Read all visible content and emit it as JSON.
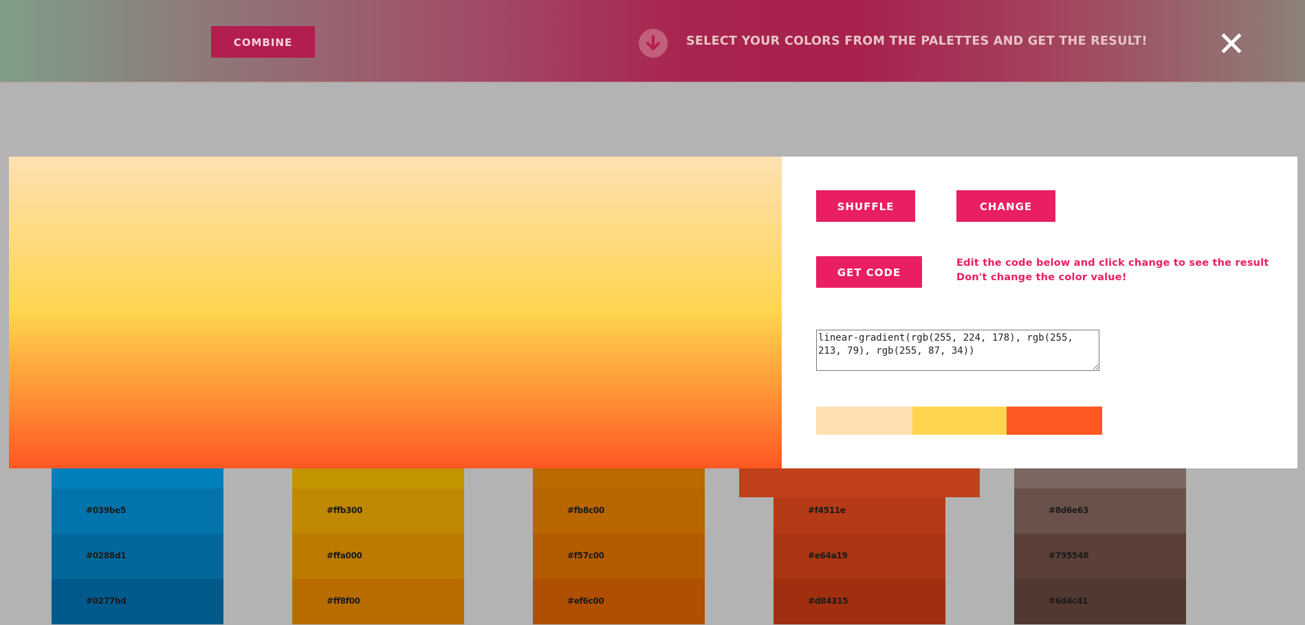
{
  "header": {
    "combine_label": "COMBINE",
    "hint_text": "SELECT YOUR COLORS FROM THE PALETTES AND GET THE RESULT!",
    "arrow_icon": "arrow-down-icon",
    "close_icon": "close-icon"
  },
  "modal": {
    "shuffle_label": "SHUFFLE",
    "change_label": "CHANGE",
    "get_code_label": "GET CODE",
    "note_line1": "Edit the code below and click change to see the result",
    "note_line2": "Don't change the color value!",
    "code_value": "linear-gradient(rgb(255, 224, 178), rgb(255, 213, 79), rgb(255, 87, 34))",
    "swatch_colors": [
      "#ffe0b2",
      "#ffd54f",
      "#ff5722"
    ],
    "preview_gradient": [
      "rgb(255, 224, 178)",
      "rgb(255, 213, 79)",
      "rgb(255, 87, 34)"
    ]
  },
  "palettes": [
    {
      "colors": [
        {
          "hex": "",
          "bg": "#0280bc"
        },
        {
          "hex": "#039be5",
          "bg": "#0273ab"
        },
        {
          "hex": "#0288d1",
          "bg": "#02689b"
        },
        {
          "hex": "#0277bd",
          "bg": "#025a8c"
        }
      ]
    },
    {
      "colors": [
        {
          "hex": "",
          "bg": "#c19400"
        },
        {
          "hex": "#ffb300",
          "bg": "#bf8800"
        },
        {
          "hex": "#ffa000",
          "bg": "#bc7b00"
        },
        {
          "hex": "#ff8f00",
          "bg": "#b96c00"
        }
      ]
    },
    {
      "colors": [
        {
          "hex": "",
          "bg": "#b96a00"
        },
        {
          "hex": "#fb8c00",
          "bg": "#b76600"
        },
        {
          "hex": "#f57c00",
          "bg": "#b45b00"
        },
        {
          "hex": "#ef6c00",
          "bg": "#b04f00"
        }
      ]
    },
    {
      "colors": [
        {
          "hex": "",
          "bg": "#c0401a"
        },
        {
          "hex": "#f4511e",
          "bg": "#b53b17"
        },
        {
          "hex": "#e64a19",
          "bg": "#aa3513"
        },
        {
          "hex": "#d84315",
          "bg": "#a02f10"
        }
      ]
    },
    {
      "colors": [
        {
          "hex": "",
          "bg": "#7a6760"
        },
        {
          "hex": "#8d6e63",
          "bg": "#6a524a"
        },
        {
          "hex": "#795548",
          "bg": "#5b4037"
        },
        {
          "hex": "#6d4c41",
          "bg": "#513831"
        }
      ]
    }
  ]
}
